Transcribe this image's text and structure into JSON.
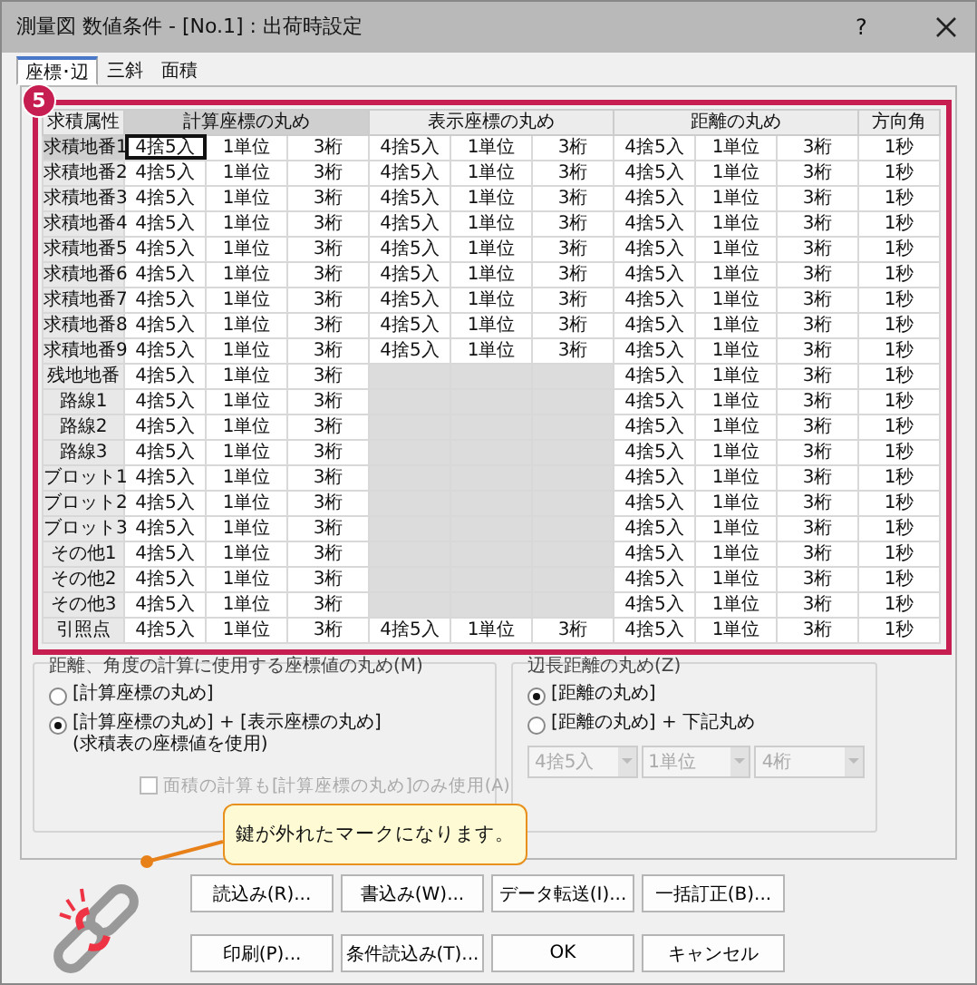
{
  "window": {
    "title": "測量図 数値条件 - [No.1] : 出荷時設定",
    "help": "?"
  },
  "tabs": [
    {
      "label": "座標･辺",
      "selected": true
    },
    {
      "label": "三斜",
      "selected": false
    },
    {
      "label": "面積",
      "selected": false
    }
  ],
  "badge": "5",
  "table": {
    "row_header": "求積属性",
    "columns": [
      {
        "label": "計算座標の丸め",
        "selected": true
      },
      {
        "label": "表示座標の丸め",
        "selected": false
      },
      {
        "label": "距離の丸め",
        "selected": false
      },
      {
        "label": "方向角",
        "selected": false
      }
    ],
    "rows": [
      {
        "label": "求積地番1",
        "selected": true,
        "cells": [
          [
            "4捨5入",
            "1単位",
            "3桁"
          ],
          [
            "4捨5入",
            "1単位",
            "3桁"
          ],
          [
            "4捨5入",
            "1単位",
            "3桁"
          ],
          [
            "1秒"
          ]
        ]
      },
      {
        "label": "求積地番2",
        "selected": false,
        "cells": [
          [
            "4捨5入",
            "1単位",
            "3桁"
          ],
          [
            "4捨5入",
            "1単位",
            "3桁"
          ],
          [
            "4捨5入",
            "1単位",
            "3桁"
          ],
          [
            "1秒"
          ]
        ]
      },
      {
        "label": "求積地番3",
        "selected": false,
        "cells": [
          [
            "4捨5入",
            "1単位",
            "3桁"
          ],
          [
            "4捨5入",
            "1単位",
            "3桁"
          ],
          [
            "4捨5入",
            "1単位",
            "3桁"
          ],
          [
            "1秒"
          ]
        ]
      },
      {
        "label": "求積地番4",
        "selected": false,
        "cells": [
          [
            "4捨5入",
            "1単位",
            "3桁"
          ],
          [
            "4捨5入",
            "1単位",
            "3桁"
          ],
          [
            "4捨5入",
            "1単位",
            "3桁"
          ],
          [
            "1秒"
          ]
        ]
      },
      {
        "label": "求積地番5",
        "selected": false,
        "cells": [
          [
            "4捨5入",
            "1単位",
            "3桁"
          ],
          [
            "4捨5入",
            "1単位",
            "3桁"
          ],
          [
            "4捨5入",
            "1単位",
            "3桁"
          ],
          [
            "1秒"
          ]
        ]
      },
      {
        "label": "求積地番6",
        "selected": false,
        "cells": [
          [
            "4捨5入",
            "1単位",
            "3桁"
          ],
          [
            "4捨5入",
            "1単位",
            "3桁"
          ],
          [
            "4捨5入",
            "1単位",
            "3桁"
          ],
          [
            "1秒"
          ]
        ]
      },
      {
        "label": "求積地番7",
        "selected": false,
        "cells": [
          [
            "4捨5入",
            "1単位",
            "3桁"
          ],
          [
            "4捨5入",
            "1単位",
            "3桁"
          ],
          [
            "4捨5入",
            "1単位",
            "3桁"
          ],
          [
            "1秒"
          ]
        ]
      },
      {
        "label": "求積地番8",
        "selected": false,
        "cells": [
          [
            "4捨5入",
            "1単位",
            "3桁"
          ],
          [
            "4捨5入",
            "1単位",
            "3桁"
          ],
          [
            "4捨5入",
            "1単位",
            "3桁"
          ],
          [
            "1秒"
          ]
        ]
      },
      {
        "label": "求積地番9",
        "selected": false,
        "cells": [
          [
            "4捨5入",
            "1単位",
            "3桁"
          ],
          [
            "4捨5入",
            "1単位",
            "3桁"
          ],
          [
            "4捨5入",
            "1単位",
            "3桁"
          ],
          [
            "1秒"
          ]
        ]
      },
      {
        "label": "残地地番",
        "selected": false,
        "cells": [
          [
            "4捨5入",
            "1単位",
            "3桁"
          ],
          null,
          [
            "4捨5入",
            "1単位",
            "3桁"
          ],
          [
            "1秒"
          ]
        ]
      },
      {
        "label": "路線1",
        "selected": false,
        "cells": [
          [
            "4捨5入",
            "1単位",
            "3桁"
          ],
          null,
          [
            "4捨5入",
            "1単位",
            "3桁"
          ],
          [
            "1秒"
          ]
        ]
      },
      {
        "label": "路線2",
        "selected": false,
        "cells": [
          [
            "4捨5入",
            "1単位",
            "3桁"
          ],
          null,
          [
            "4捨5入",
            "1単位",
            "3桁"
          ],
          [
            "1秒"
          ]
        ]
      },
      {
        "label": "路線3",
        "selected": false,
        "cells": [
          [
            "4捨5入",
            "1単位",
            "3桁"
          ],
          null,
          [
            "4捨5入",
            "1単位",
            "3桁"
          ],
          [
            "1秒"
          ]
        ]
      },
      {
        "label": "ブロット1",
        "selected": false,
        "cells": [
          [
            "4捨5入",
            "1単位",
            "3桁"
          ],
          null,
          [
            "4捨5入",
            "1単位",
            "3桁"
          ],
          [
            "1秒"
          ]
        ]
      },
      {
        "label": "ブロット2",
        "selected": false,
        "cells": [
          [
            "4捨5入",
            "1単位",
            "3桁"
          ],
          null,
          [
            "4捨5入",
            "1単位",
            "3桁"
          ],
          [
            "1秒"
          ]
        ]
      },
      {
        "label": "ブロット3",
        "selected": false,
        "cells": [
          [
            "4捨5入",
            "1単位",
            "3桁"
          ],
          null,
          [
            "4捨5入",
            "1単位",
            "3桁"
          ],
          [
            "1秒"
          ]
        ]
      },
      {
        "label": "その他1",
        "selected": false,
        "cells": [
          [
            "4捨5入",
            "1単位",
            "3桁"
          ],
          null,
          [
            "4捨5入",
            "1単位",
            "3桁"
          ],
          [
            "1秒"
          ]
        ]
      },
      {
        "label": "その他2",
        "selected": false,
        "cells": [
          [
            "4捨5入",
            "1単位",
            "3桁"
          ],
          null,
          [
            "4捨5入",
            "1単位",
            "3桁"
          ],
          [
            "1秒"
          ]
        ]
      },
      {
        "label": "その他3",
        "selected": false,
        "cells": [
          [
            "4捨5入",
            "1単位",
            "3桁"
          ],
          null,
          [
            "4捨5入",
            "1単位",
            "3桁"
          ],
          [
            "1秒"
          ]
        ]
      },
      {
        "label": "引照点",
        "selected": false,
        "cells": [
          [
            "4捨5入",
            "1単位",
            "3桁"
          ],
          [
            "4捨5入",
            "1単位",
            "3桁"
          ],
          [
            "4捨5入",
            "1単位",
            "3桁"
          ],
          [
            "1秒"
          ]
        ]
      }
    ]
  },
  "coord_group": {
    "title": "距離、角度の計算に使用する座標値の丸め(M)",
    "options": [
      {
        "lines": [
          "[計算座標の丸め]"
        ],
        "selected": false
      },
      {
        "lines": [
          "[計算座標の丸め] + [表示座標の丸め]",
          "(求積表の座標値を使用)"
        ],
        "selected": true
      }
    ],
    "checkbox": {
      "label": "面積の計算も[計算座標の丸め]のみ使用(A)",
      "checked": false,
      "disabled": true
    }
  },
  "length_group": {
    "title": "辺長距離の丸め(Z)",
    "options": [
      {
        "lines": [
          "[距離の丸め]"
        ],
        "selected": true
      },
      {
        "lines": [
          "[距離の丸め] + 下記丸め"
        ],
        "selected": false
      }
    ],
    "dropdowns": [
      {
        "value": "4捨5入",
        "disabled": true
      },
      {
        "value": "1単位",
        "disabled": true
      },
      {
        "value": "4桁",
        "disabled": true
      }
    ]
  },
  "callout": "鍵が外れたマークになります。",
  "buttons": [
    [
      "読込み(R)...",
      "書込み(W)...",
      "データ転送(I)...",
      "一括訂正(B)..."
    ],
    [
      "印刷(P)...",
      "条件読込み(T)...",
      "OK",
      "キャンセル"
    ]
  ]
}
